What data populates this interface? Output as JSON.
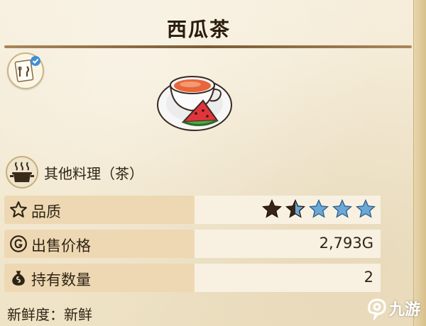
{
  "dish": {
    "name": "西瓜茶",
    "icon": "watermelon-tea-cup-icon"
  },
  "recipe_badge": {
    "icon": "recipe-card-check-icon"
  },
  "category": {
    "icon": "cooking-pot-icon",
    "text": "其他料理（茶）"
  },
  "stats": {
    "quality": {
      "icon": "star-outline-icon",
      "label": "品质",
      "stars_filled": 1.5,
      "stars_total": 5
    },
    "price": {
      "icon": "gold-coin-g-icon",
      "label": "出售价格",
      "value": "2,793G"
    },
    "owned": {
      "icon": "money-bag-icon",
      "label": "持有数量",
      "value": "2"
    }
  },
  "freshness": {
    "label": "新鲜度：",
    "value": "新鲜"
  },
  "watermark": {
    "text": "九游",
    "icon": "jiuyou-logo-icon"
  },
  "colors": {
    "title_rule": "#7b5c34",
    "label_band": "#edd8b3",
    "star_dark": "#3a2515",
    "star_blue": "#6aa8d8"
  }
}
